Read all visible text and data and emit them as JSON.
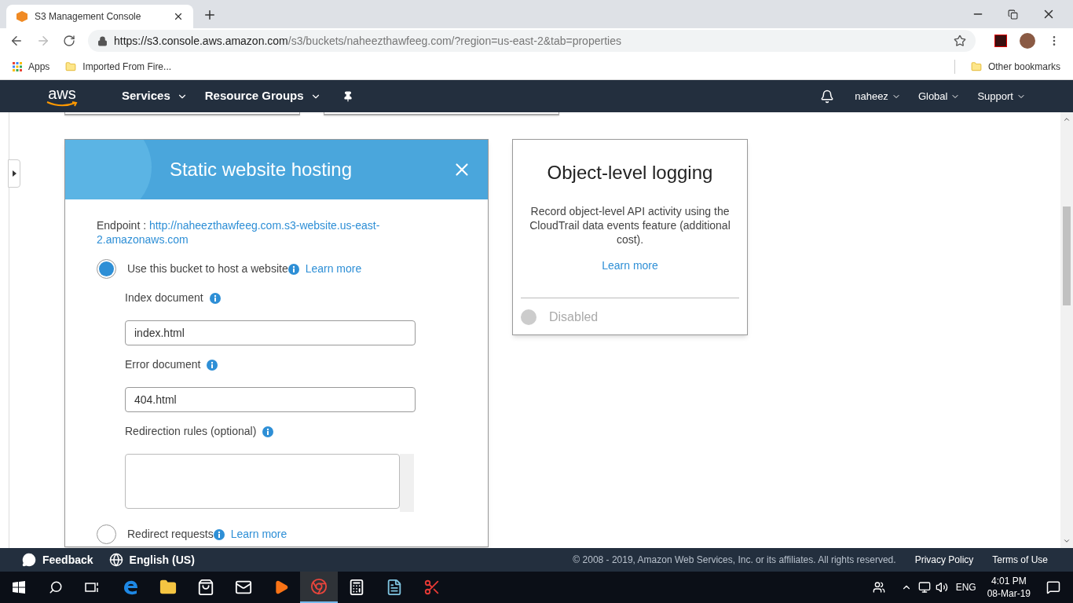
{
  "browser": {
    "tab_title": "S3 Management Console",
    "url_host": "https://s3.console.aws.amazon.com",
    "url_path": "/s3/buckets/naheezthawfeeg.com/?region=us-east-2&tab=properties",
    "bookmarks": [
      {
        "label": "Apps",
        "kind": "apps"
      },
      {
        "label": "Imported From Fire...",
        "kind": "folder"
      }
    ],
    "other_bookmarks": "Other bookmarks"
  },
  "nav": {
    "logo": "aws",
    "menus": [
      "Services",
      "Resource Groups"
    ],
    "right_menus": [
      "naheez",
      "Global",
      "Support"
    ]
  },
  "hosting_card": {
    "title": "Static website hosting",
    "endpoint_label": "Endpoint : ",
    "endpoint_url": "http://naheezthawfeeg.com.s3-website.us-east-2.amazonaws.com",
    "options": [
      {
        "label": "Use this bucket to host a website",
        "link": "Learn more",
        "selected": true
      },
      {
        "label": "Redirect requests",
        "link": "Learn more",
        "selected": false
      }
    ],
    "fields": [
      {
        "label": "Index document",
        "value": "index.html",
        "kind": "input"
      },
      {
        "label": "Error document",
        "value": "404.html",
        "kind": "input"
      },
      {
        "label": "Redirection rules (optional)",
        "kind": "textarea"
      }
    ]
  },
  "logging_card": {
    "title": "Object-level logging",
    "description": "Record object-level API activity using the CloudTrail data events feature (additional cost).",
    "link": "Learn more",
    "status": "Disabled",
    "enabled": false
  },
  "footer": {
    "feedback": "Feedback",
    "language": "English (US)",
    "copyright": "© 2008 - 2019, Amazon Web Services, Inc. or its affiliates. All rights reserved.",
    "links": [
      "Privacy Policy",
      "Terms of Use"
    ]
  },
  "taskbar": {
    "apps": [
      {
        "kind": "edge",
        "selected": false
      },
      {
        "kind": "explorer",
        "selected": false
      },
      {
        "kind": "store",
        "selected": false
      },
      {
        "kind": "mail",
        "selected": false
      },
      {
        "kind": "media",
        "selected": false
      },
      {
        "kind": "chrome",
        "selected": true
      },
      {
        "kind": "calculator",
        "selected": false
      },
      {
        "kind": "notepad",
        "selected": false
      },
      {
        "kind": "snipping",
        "selected": false
      }
    ],
    "language": "ENG",
    "time": "4:01 PM",
    "date": "08-Mar-19"
  }
}
